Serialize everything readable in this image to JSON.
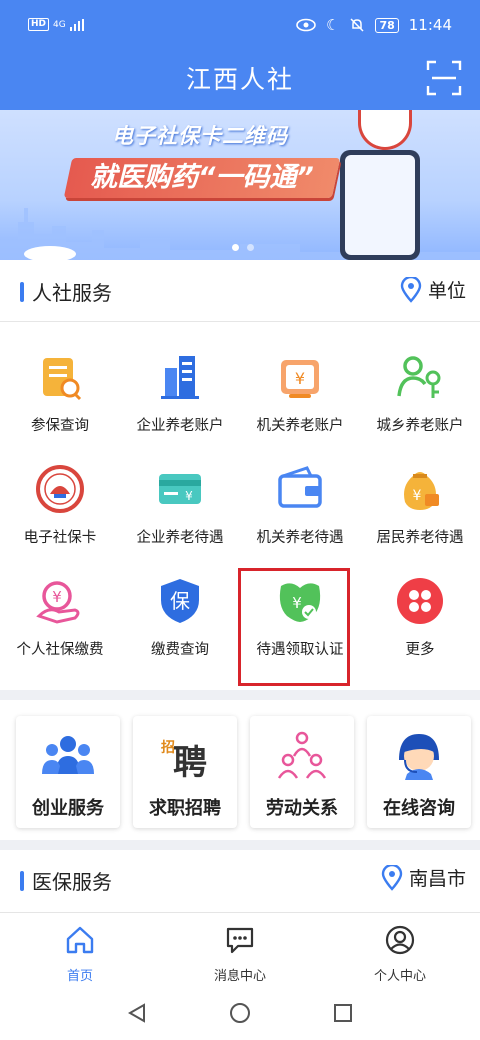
{
  "status": {
    "network": "4G",
    "hd": "HD",
    "battery": "78",
    "time": "11:44"
  },
  "header": {
    "title": "江西人社",
    "scan_icon": "scan-icon"
  },
  "banner": {
    "subtitle": "电子社保卡二维码",
    "headline": "就医购药“一码通”"
  },
  "services": {
    "title": "人社服务",
    "location": "单位",
    "items": [
      {
        "label": "参保查询",
        "icon": "insurance-query-icon"
      },
      {
        "label": "企业养老账户",
        "icon": "enterprise-pension-account-icon"
      },
      {
        "label": "机关养老账户",
        "icon": "government-pension-account-icon"
      },
      {
        "label": "城乡养老账户",
        "icon": "urban-rural-pension-account-icon"
      },
      {
        "label": "电子社保卡",
        "icon": "social-security-card-icon"
      },
      {
        "label": "企业养老待遇",
        "icon": "enterprise-pension-benefit-icon"
      },
      {
        "label": "机关养老待遇",
        "icon": "government-pension-benefit-icon"
      },
      {
        "label": "居民养老待遇",
        "icon": "resident-pension-benefit-icon"
      },
      {
        "label": "个人社保缴费",
        "icon": "personal-payment-icon"
      },
      {
        "label": "缴费查询",
        "icon": "payment-query-icon"
      },
      {
        "label": "待遇领取认证",
        "icon": "benefit-certification-icon"
      },
      {
        "label": "更多",
        "icon": "more-icon"
      }
    ]
  },
  "quick": [
    {
      "label": "创业服务",
      "icon": "entrepreneurship-icon"
    },
    {
      "label": "求职招聘",
      "icon": "recruitment-icon"
    },
    {
      "label": "劳动关系",
      "icon": "labor-relations-icon"
    },
    {
      "label": "在线咨询",
      "icon": "online-consult-icon"
    }
  ],
  "medical": {
    "title": "医保服务",
    "location": "南昌市"
  },
  "nav": [
    {
      "label": "首页",
      "icon": "home-icon",
      "active": true
    },
    {
      "label": "消息中心",
      "icon": "message-icon"
    },
    {
      "label": "个人中心",
      "icon": "user-icon"
    }
  ],
  "colors": {
    "brand": "#4a86f2",
    "highlight": "#d8242b"
  }
}
